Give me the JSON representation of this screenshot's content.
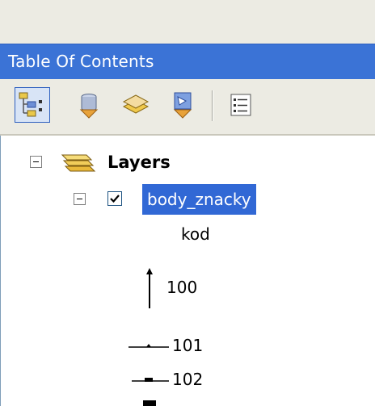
{
  "panel": {
    "title": "Table Of Contents"
  },
  "toolbar": {
    "buttons": [
      {
        "icon": "list-by-drawing-order-icon",
        "selected": true
      },
      {
        "icon": "list-by-source-icon",
        "selected": false
      },
      {
        "icon": "list-by-visibility-icon",
        "selected": false
      },
      {
        "icon": "list-by-selection-icon",
        "selected": false
      },
      {
        "icon": "options-icon",
        "selected": false
      }
    ]
  },
  "tree": {
    "root": {
      "label": "Layers",
      "icon": "layers-stack-icon",
      "expanded": true
    },
    "layer": {
      "name": "body_znacky",
      "checked": true,
      "expanded": true,
      "field": "kod",
      "symbols": [
        {
          "value": "100",
          "icon": "vertical-arrow-symbol-icon"
        },
        {
          "value": "101",
          "icon": "line-dot-symbol-icon"
        },
        {
          "value": "102",
          "icon": "line-square-symbol-icon"
        }
      ]
    }
  },
  "colors": {
    "title_bar": "#3b73d6",
    "selection": "#3168d5",
    "toolbar_bg": "#ecebe3"
  }
}
